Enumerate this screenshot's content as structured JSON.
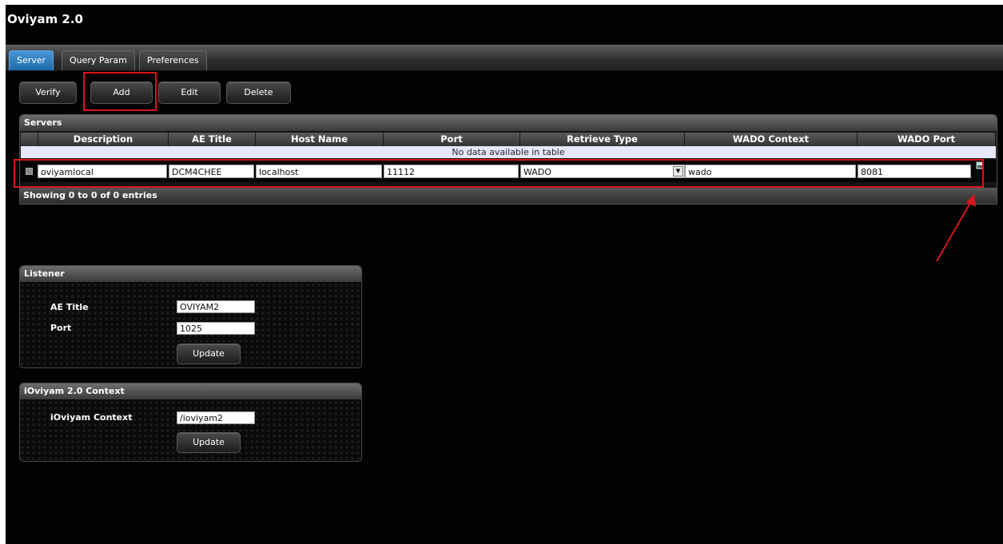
{
  "app": {
    "title": "Oviyam 2.0"
  },
  "tabs": [
    {
      "label": "Server",
      "active": true
    },
    {
      "label": "Query Param",
      "active": false
    },
    {
      "label": "Preferences",
      "active": false
    }
  ],
  "toolbar": {
    "verify": "Verify",
    "add": "Add",
    "edit": "Edit",
    "delete": "Delete"
  },
  "servers": {
    "title": "Servers",
    "columns": [
      "Description",
      "AE Title",
      "Host Name",
      "Port",
      "Retrieve Type",
      "WADO Context",
      "WADO Port"
    ],
    "empty_message": "No data available in table",
    "edit_row": {
      "description": "oviyamlocal",
      "ae_title": "DCM4CHEE",
      "host_name": "localhost",
      "port": "11112",
      "retrieve_type": "WADO",
      "wado_context": "wado",
      "wado_port": "8081"
    },
    "info": "Showing 0 to 0 of 0 entries"
  },
  "listener": {
    "title": "Listener",
    "ae_title_label": "AE Title",
    "ae_title_value": "OVIYAM2",
    "port_label": "Port",
    "port_value": "1025",
    "update": "Update"
  },
  "ioviyam": {
    "title": "iOviyam 2.0 Context",
    "context_label": "iOviyam Context",
    "context_value": "/ioviyam2",
    "update": "Update"
  },
  "colors": {
    "accent_tab": "#2f80c4",
    "highlight": "#d9141c",
    "background": "#020202"
  }
}
